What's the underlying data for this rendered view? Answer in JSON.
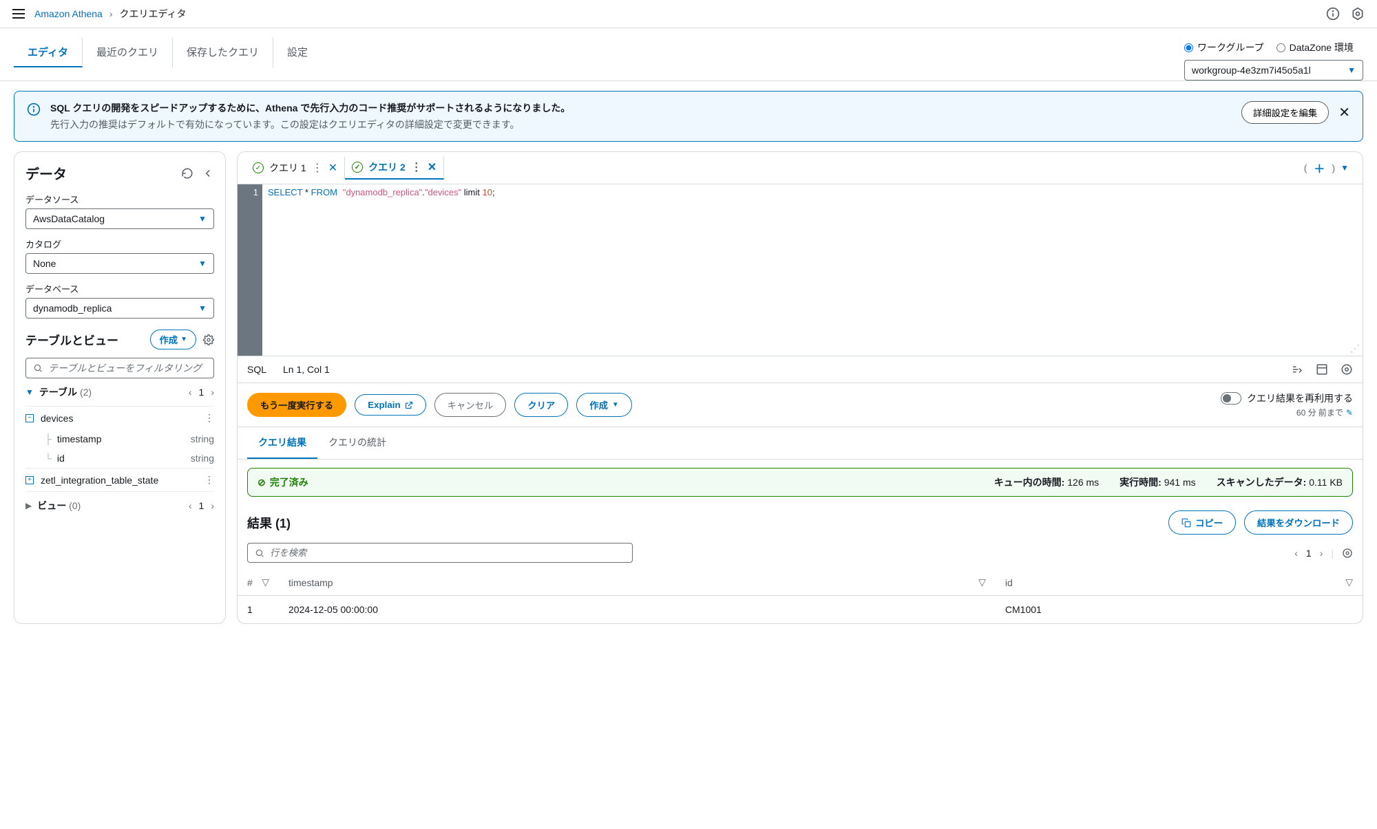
{
  "breadcrumb": {
    "service": "Amazon Athena",
    "current": "クエリエディタ"
  },
  "topTabs": {
    "editor": "エディタ",
    "recent": "最近のクエリ",
    "saved": "保存したクエリ",
    "settings": "設定"
  },
  "workgroupSelector": {
    "workgroup_label": "ワークグループ",
    "datazone_label": "DataZone 環境",
    "selected": "workgroup-4e3zm7i45o5a1l"
  },
  "banner": {
    "title": "SQL クエリの開発をスピードアップするために、Athena で先行入力のコード推奨がサポートされるようになりました。",
    "desc": "先行入力の推奨はデフォルトで有効になっています。この設定はクエリエディタの詳細設定で変更できます。",
    "button": "詳細設定を編集"
  },
  "sidebar": {
    "title": "データ",
    "datasource_label": "データソース",
    "datasource_value": "AwsDataCatalog",
    "catalog_label": "カタログ",
    "catalog_value": "None",
    "database_label": "データベース",
    "database_value": "dynamodb_replica",
    "tables_views_title": "テーブルとビュー",
    "create_button": "作成",
    "filter_placeholder": "テーブルとビューをフィルタリング",
    "tables_label": "テーブル",
    "tables_count": "(2)",
    "tables_page": "1",
    "table1": "devices",
    "table1_col1_name": "timestamp",
    "table1_col1_type": "string",
    "table1_col2_name": "id",
    "table1_col2_type": "string",
    "table2": "zetl_integration_table_state",
    "views_label": "ビュー",
    "views_count": "(0)",
    "views_page": "1"
  },
  "queryTabs": {
    "tab1": "クエリ 1",
    "tab2": "クエリ 2"
  },
  "editor": {
    "line_no": "1",
    "sql_select": "SELECT",
    "sql_star": " * ",
    "sql_from": "FROM",
    "sql_str1": "\"dynamodb_replica\"",
    "sql_dot": ".",
    "sql_str2": "\"devices\"",
    "sql_limit": " limit ",
    "sql_num": "10",
    "sql_semi": ";"
  },
  "statusBar": {
    "lang": "SQL",
    "pos": "Ln 1, Col 1"
  },
  "actions": {
    "run": "もう一度実行する",
    "explain": "Explain",
    "cancel": "キャンセル",
    "clear": "クリア",
    "create": "作成",
    "reuse_label": "クエリ結果を再利用する",
    "reuse_sub": "60 分 前まで"
  },
  "resultTabs": {
    "results": "クエリ結果",
    "stats": "クエリの統計"
  },
  "completion": {
    "status": "完了済み",
    "queue_label": "キュー内の時間:",
    "queue_value": "126 ms",
    "runtime_label": "実行時間:",
    "runtime_value": "941 ms",
    "scanned_label": "スキャンしたデータ:",
    "scanned_value": "0.11 KB"
  },
  "results": {
    "title": "結果 (1)",
    "copy": "コピー",
    "download": "結果をダウンロード",
    "search_placeholder": "行を検索",
    "page": "1",
    "col_num": "#",
    "col_ts": "timestamp",
    "col_id": "id",
    "row1_num": "1",
    "row1_ts": "2024-12-05 00:00:00",
    "row1_id": "CM1001"
  }
}
